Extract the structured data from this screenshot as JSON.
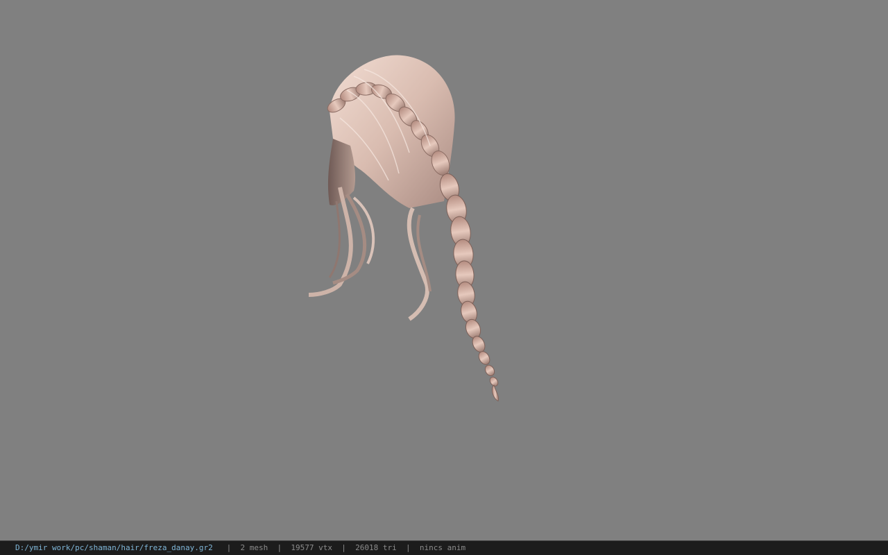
{
  "viewport": {
    "background": "#808080",
    "model": "hair-mesh"
  },
  "status": {
    "path": "D:/ymir work/pc/shaman/hair/freza_danay.gr2",
    "mesh": "2 mesh",
    "vtx": "19577 vtx",
    "tri": "26018 tri",
    "anim": "nincs anim",
    "separator": "|",
    "colors": {
      "path": "#7fb6d8",
      "text": "#8c8c8c",
      "bar": "#1c1c1c"
    }
  }
}
